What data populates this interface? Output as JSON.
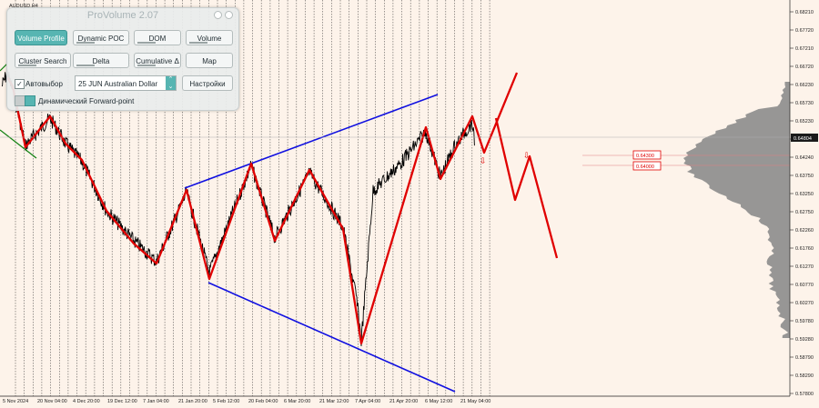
{
  "symbol_label": "AUDUSD,H4",
  "panel": {
    "title": "ProVolume 2.07",
    "buttons": [
      {
        "label": "Volume Profile",
        "active": true
      },
      {
        "label": "Dynamic POC",
        "active": false
      },
      {
        "label": "DOM",
        "active": false
      },
      {
        "label": "Volume",
        "active": false
      },
      {
        "label": "Cluster Search",
        "active": false
      },
      {
        "label": "Delta",
        "active": false
      },
      {
        "label": "Cumulative Δ",
        "active": false
      },
      {
        "label": "Map",
        "active": false
      }
    ],
    "auto_select_label": "Автовыбор",
    "auto_select_checked": true,
    "instrument_value": "25 JUN Australian Dollar",
    "settings_label": "Настройки",
    "forward_label": "Динамический Forward-point"
  },
  "price_axis": {
    "labels": [
      "0.68210",
      "0.67720",
      "0.67210",
      "0.66720",
      "0.66230",
      "0.65730",
      "0.65230",
      "0.64730",
      "0.64240",
      "0.63750",
      "0.63250",
      "0.62750",
      "0.62260",
      "0.61760",
      "0.61270",
      "0.60770",
      "0.60270",
      "0.59780",
      "0.59280",
      "0.58790",
      "0.58290",
      "0.57800"
    ],
    "current_price": "0.64804"
  },
  "price_tags": [
    {
      "label": "0.64300",
      "value": 0.643
    },
    {
      "label": "0.64000",
      "value": 0.64
    }
  ],
  "time_axis": {
    "labels": [
      "5 Nov 2024",
      "20 Nov 04:00",
      "4 Dec 20:00",
      "19 Dec 12:00",
      "7 Jan 04:00",
      "21 Jan 20:00",
      "5 Feb 12:00",
      "20 Feb 04:00",
      "6 Mar 20:00",
      "21 Mar 12:00",
      "7 Apr 04:00",
      "21 Apr 20:00",
      "6 May 12:00",
      "21 May 04:00"
    ]
  },
  "colors": {
    "background": "#fdf3ea",
    "candle": "#000000",
    "zigzag": "#e00000",
    "trend_lines": "#0000e0",
    "volume_profile": "#8a8a8a",
    "panel_accent": "#57b5b2"
  },
  "icons": {
    "down_arrow": "down-arrow-icon"
  }
}
